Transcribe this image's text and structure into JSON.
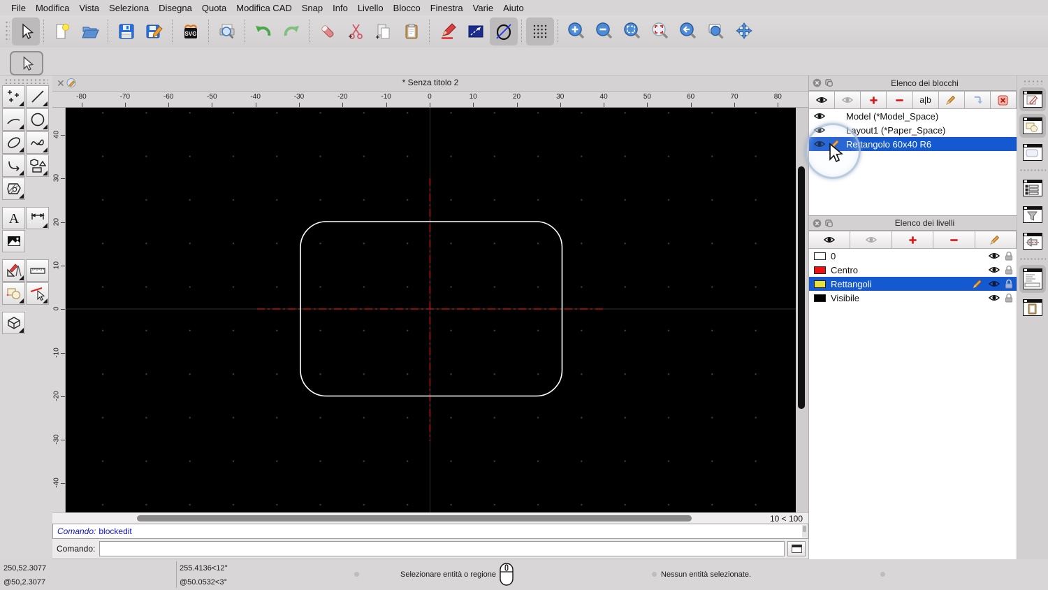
{
  "menu": {
    "items": [
      "File",
      "Modifica",
      "Vista",
      "Seleziona",
      "Disegna",
      "Quota",
      "Modifica CAD",
      "Snap",
      "Info",
      "Livello",
      "Blocco",
      "Finestra",
      "Varie",
      "Aiuto"
    ]
  },
  "toolbar": {
    "svg_icon_label": "SVG"
  },
  "window": {
    "title": "* Senza titolo 2"
  },
  "rulers": {
    "horizontal": [
      "-80",
      "-70",
      "-60",
      "-50",
      "-40",
      "-30",
      "-20",
      "-10",
      "0",
      "10",
      "20",
      "30",
      "40",
      "50",
      "60",
      "70",
      "80"
    ],
    "vertical": [
      "40",
      "30",
      "20",
      "10",
      "0",
      "-10",
      "-20",
      "-30",
      "-40"
    ]
  },
  "scroll": {
    "grid_status": "10 < 100"
  },
  "command": {
    "history_label": "Comando:",
    "history_value": "blockedit",
    "prompt_label": "Comando:",
    "input_value": ""
  },
  "blocks_panel": {
    "title": "Elenco dei blocchi",
    "rename_label": "a|b",
    "items": [
      {
        "label": "Model (*Model_Space)",
        "selected": false
      },
      {
        "label": "Layout1 (*Paper_Space)",
        "selected": false
      },
      {
        "label": "Rettangolo 60x40 R6",
        "selected": true
      }
    ]
  },
  "layers_panel": {
    "title": "Elenco dei livelli",
    "items": [
      {
        "label": "0",
        "color": "#ffffff",
        "selected": false
      },
      {
        "label": "Centro",
        "color": "#ee1111",
        "selected": false
      },
      {
        "label": "Rettangoli",
        "color": "#e5e040",
        "selected": true
      },
      {
        "label": "Visibile",
        "color": "#000000",
        "selected": false
      }
    ]
  },
  "status": {
    "coords_abs": "250,52.3077",
    "coords_rel": "@50,2.3077",
    "polar_abs": "255.4136<12°",
    "polar_rel": "@50.0532<3°",
    "hint": "Selezionare entità o regione",
    "selection_info": "Nessun entità selezionate."
  },
  "colors": {
    "selection_blue": "#1559d1",
    "command_text_blue": "#1414cc",
    "centerline_red": "#e41212",
    "entity_white": "#ffffff",
    "layer_yellow": "#e5e040",
    "layer_red": "#ee1111"
  }
}
